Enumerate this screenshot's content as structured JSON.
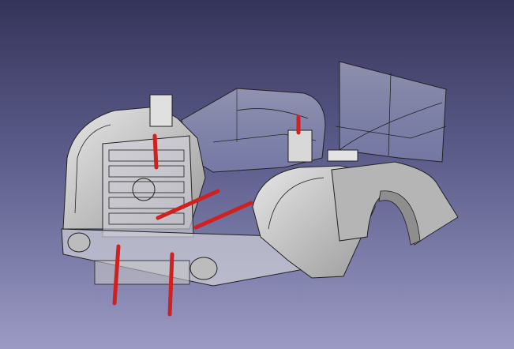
{
  "viewport": {
    "background_top": "#34345a",
    "background_bottom": "#9a9ac4"
  },
  "model": {
    "body_color": "#c9c9c9",
    "glass_color": "#b8c0d8",
    "edge_color": "#1e1e1e",
    "pin_color": "#d02020",
    "parts": [
      "hood",
      "grille",
      "front-bumper",
      "left-fender",
      "cab-roof",
      "rear-fender",
      "rear-wall",
      "mounting-pins"
    ]
  }
}
